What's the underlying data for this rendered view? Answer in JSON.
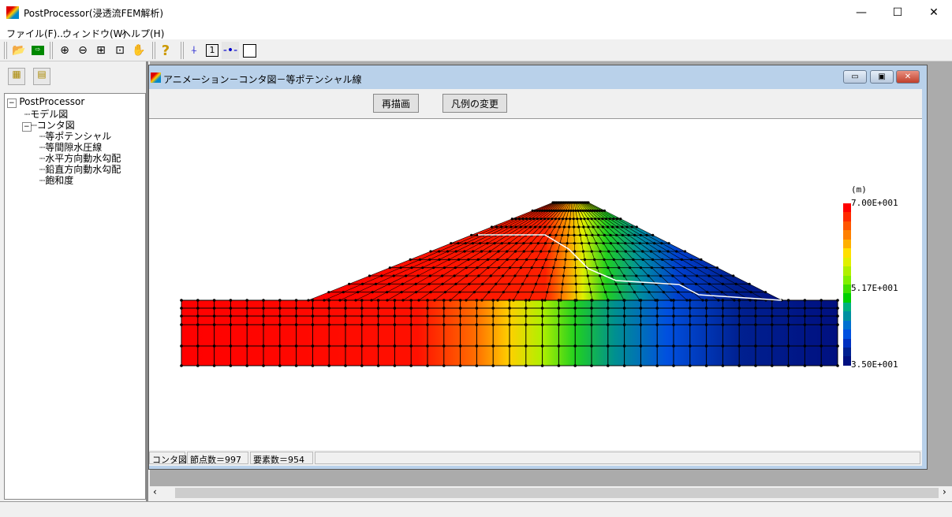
{
  "app": {
    "title": "PostProcessor(浸透流FEM解析)",
    "minimize": "—",
    "maximize": "☐",
    "close": "✕"
  },
  "menu": [
    "ファイル(F)...",
    "ウィンドウ(W)",
    "ヘルプ(H)"
  ],
  "toolbar_icons": [
    "open-folder-icon",
    "exit-icon",
    "zoom-in-icon",
    "zoom-out-icon",
    "fit-icon",
    "frame-icon",
    "pan-hand-icon",
    "help-icon",
    "node-number-icon",
    "element-number-icon",
    "node-icon",
    "element-icon"
  ],
  "panel_icons": [
    "tree-expand-icon",
    "tree-collapse-icon"
  ],
  "tree": {
    "root": "PostProcessor",
    "items": [
      {
        "label": "モデル図",
        "level": 1
      },
      {
        "label": "コンタ図",
        "level": 1
      },
      {
        "label": "等ポテンシャル",
        "level": 2
      },
      {
        "label": "等間隙水圧線",
        "level": 2
      },
      {
        "label": "水平方向動水勾配",
        "level": 2
      },
      {
        "label": "鉛直方向動水勾配",
        "level": 2
      },
      {
        "label": "飽和度",
        "level": 2
      }
    ]
  },
  "child": {
    "title": "アニメーション－コンタ図－等ポテンシャル線",
    "redraw": "再描画",
    "legend_change": "凡例の変更"
  },
  "legend": {
    "unit": "(m)",
    "max": "7.00E+001",
    "mid": "5.17E+001",
    "min": "3.50E+001",
    "colors": [
      "#ff0000",
      "#ff2a00",
      "#ff5500",
      "#ff8000",
      "#ffb000",
      "#ffe000",
      "#e0f000",
      "#b0f000",
      "#80f000",
      "#40e000",
      "#00d000",
      "#00b080",
      "#0090a0",
      "#0070d0",
      "#0050e0",
      "#0030c0",
      "#002090",
      "#001080"
    ]
  },
  "status": {
    "mode": "コンタ図",
    "nodes": "節点数＝997",
    "elements": "要素数＝954"
  },
  "scroll": {
    "left": "‹",
    "right": "›"
  }
}
